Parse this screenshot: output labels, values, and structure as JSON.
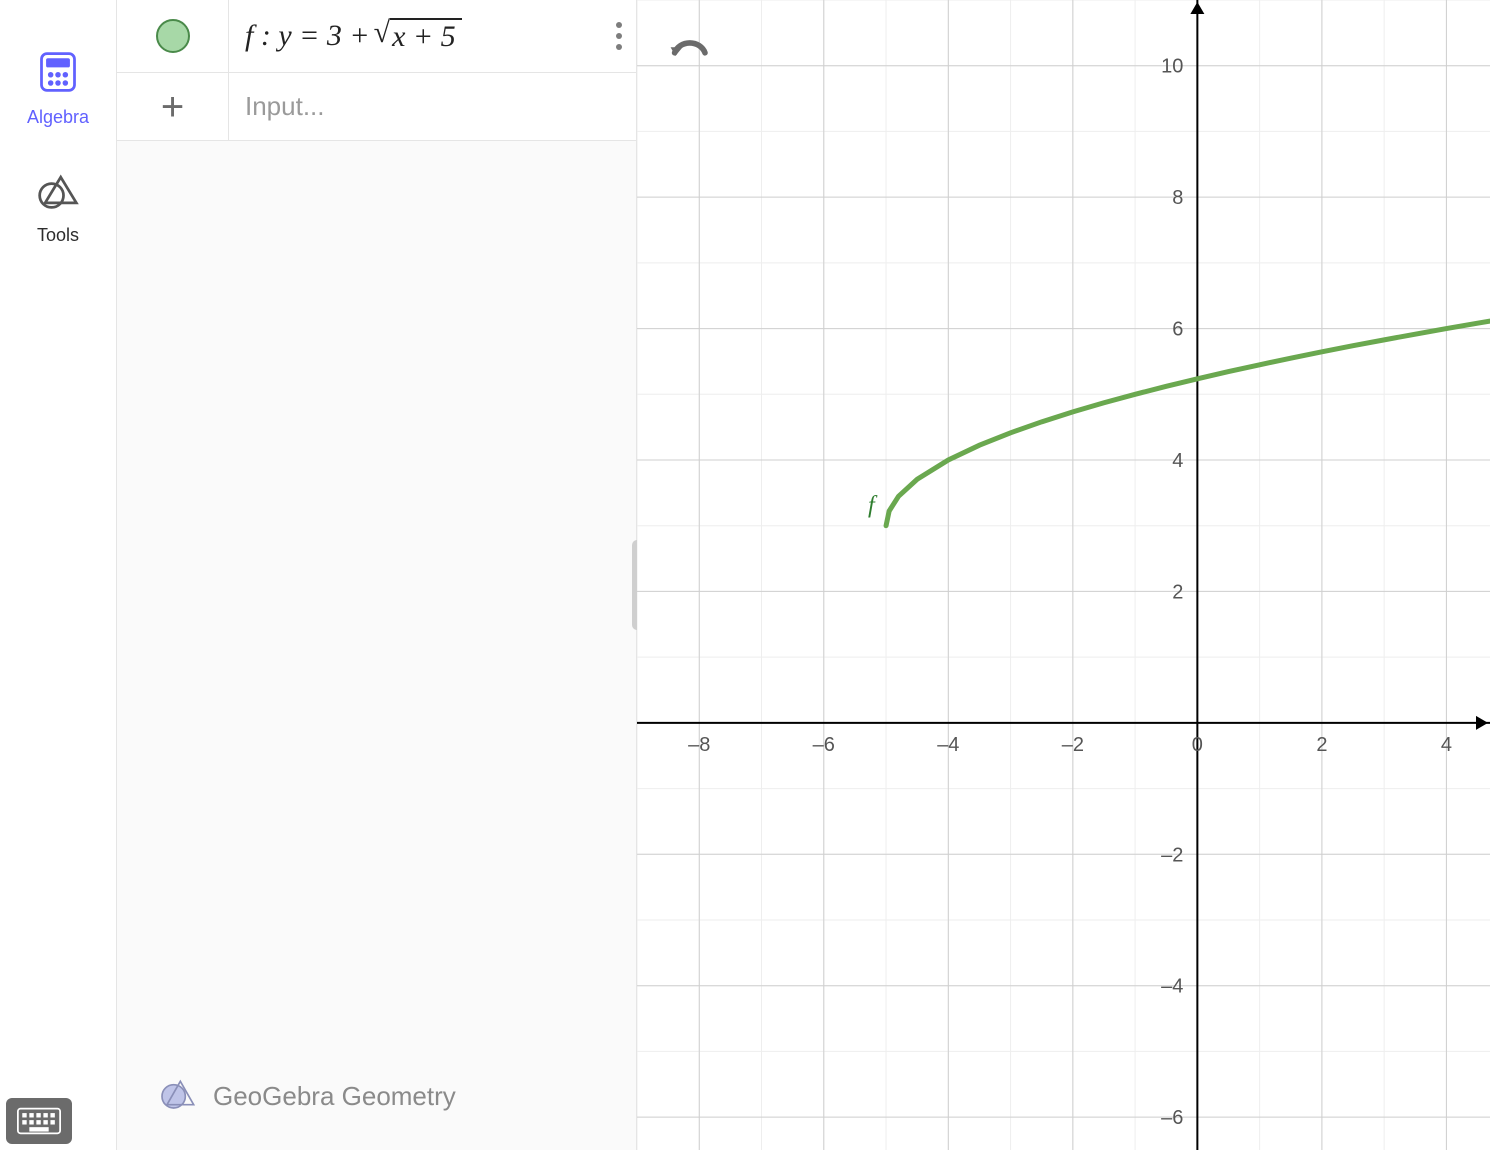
{
  "sidebar": {
    "algebra_label": "Algebra",
    "tools_label": "Tools"
  },
  "algebra": {
    "expressions": [
      {
        "name": "f",
        "prefix": "f : y = 3 + ",
        "sqrt_of": "x + 5",
        "color": "#6aa84f"
      }
    ],
    "input_placeholder": "Input..."
  },
  "footer_brand": "GeoGebra Geometry",
  "chart_data": {
    "type": "line",
    "title": "",
    "xlabel": "",
    "ylabel": "",
    "xlim": [
      -9,
      4.7
    ],
    "ylim": [
      -6.5,
      11
    ],
    "series": [
      {
        "name": "f",
        "label": "f",
        "color": "#6aa84f",
        "formula": "y = 3 + sqrt(x + 5)",
        "domain_start": -5,
        "x": [
          -5,
          -4.95,
          -4.8,
          -4.5,
          -4,
          -3.5,
          -3,
          -2.5,
          -2,
          -1.5,
          -1,
          -0.5,
          0,
          0.5,
          1,
          1.5,
          2,
          2.5,
          3,
          3.5,
          4,
          4.5,
          4.7
        ],
        "y": [
          3,
          3.224,
          3.447,
          3.707,
          4,
          4.225,
          4.414,
          4.581,
          4.732,
          4.871,
          5,
          5.121,
          5.236,
          5.345,
          5.449,
          5.55,
          5.646,
          5.739,
          5.828,
          5.915,
          6,
          6.082,
          6.114
        ]
      }
    ],
    "x_ticks": [
      -8,
      -6,
      -4,
      -2,
      0,
      2,
      4
    ],
    "y_ticks": [
      -6,
      -4,
      -2,
      2,
      4,
      6,
      8,
      10
    ]
  }
}
